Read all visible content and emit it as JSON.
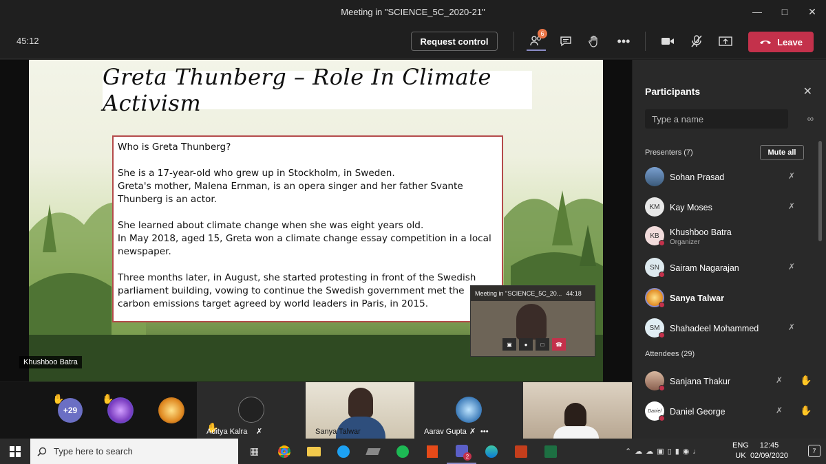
{
  "window": {
    "title": "Meeting in \"SCIENCE_5C_2020-21\""
  },
  "toolbar": {
    "timer": "45:12",
    "request_control_label": "Request control",
    "participants_badge": "6",
    "leave_label": "Leave",
    "icons": [
      "participants-icon",
      "chat-icon",
      "raise-hand-icon",
      "more-icon",
      "camera-icon",
      "mic-muted-icon",
      "share-icon",
      "phone-icon"
    ]
  },
  "slide": {
    "title": "Greta Thunberg – Role In Climate Activism",
    "question": "Who is Greta Thunberg?",
    "para1_line1": "She is a 17-year-old who grew up in Stockholm, in Sweden.",
    "para1_line2": "Greta's mother, Malena Ernman, is an opera singer and her father Svante Thunberg is an actor.",
    "para2_line1": "She learned about climate change when she was eight years old.",
    "para2_line2": "In May 2018, aged 15, Greta won a climate change essay competition in a local newspaper.",
    "para3": "Three months later, in August, she started protesting in front of the Swedish parliament building, vowing to continue the Swedish government met the carbon emissions target agreed by world leaders in Paris, in 2015."
  },
  "mini_window": {
    "title": "Meeting in \"SCIENCE_5C_20...",
    "time": "44:18"
  },
  "speaker_label": "Khushboo Batra",
  "strip": {
    "overflow_count": "+29",
    "tiles": [
      {
        "name": "Aditya Kalra"
      },
      {
        "name": "Sanya Talwar"
      },
      {
        "name": "Aarav Gupta"
      }
    ]
  },
  "participants": {
    "title": "Participants",
    "search_placeholder": "Type a name",
    "presenters_header": "Presenters (7)",
    "mute_all_label": "Mute all",
    "presenters": [
      {
        "name": "Sohan Prasad",
        "initials": ""
      },
      {
        "name": "Kay Moses",
        "initials": "KM"
      },
      {
        "name": "Khushboo Batra",
        "initials": "KB",
        "role": "Organizer"
      },
      {
        "name": "Sairam Nagarajan",
        "initials": "SN"
      },
      {
        "name": "Sanya Talwar",
        "initials": ""
      },
      {
        "name": "Shahadeel Mohammed",
        "initials": "SM"
      }
    ],
    "attendees_header": "Attendees (29)",
    "attendees": [
      {
        "name": "Sanjana Thakur"
      },
      {
        "name": "Daniel George"
      }
    ]
  },
  "taskbar": {
    "search_placeholder": "Type here to search",
    "teams_badge": "2",
    "lang_top": "ENG",
    "lang_bottom": "UK",
    "time": "12:45",
    "date": "02/09/2020",
    "notif_count": "7"
  },
  "colors": {
    "leave": "#c4314b",
    "badge": "#e97548",
    "hand": "#f6b73c"
  }
}
